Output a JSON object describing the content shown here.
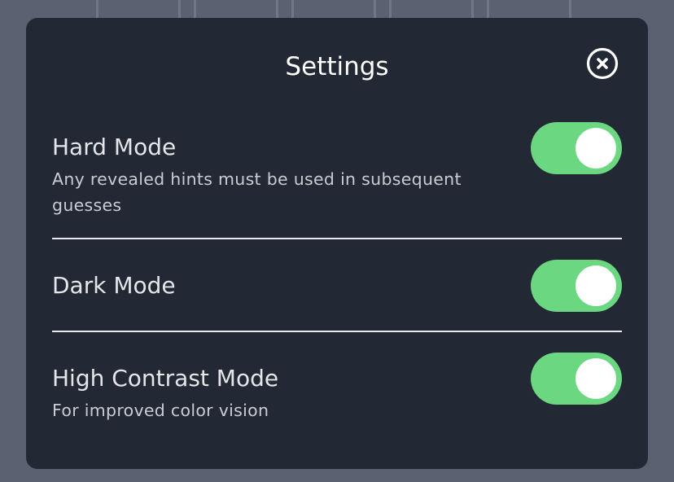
{
  "modal": {
    "title": "Settings"
  },
  "settings": [
    {
      "label": "Hard Mode",
      "description": "Any revealed hints must be used in subsequent guesses",
      "enabled": true
    },
    {
      "label": "Dark Mode",
      "description": "",
      "enabled": true
    },
    {
      "label": "High Contrast Mode",
      "description": "For improved color vision",
      "enabled": true
    }
  ],
  "colors": {
    "modal_background": "#222834",
    "toggle_on": "#6bd881",
    "backdrop": "#5a6170",
    "text_primary": "#e4e6ea"
  },
  "icons": {
    "close": "close-circle-icon"
  }
}
